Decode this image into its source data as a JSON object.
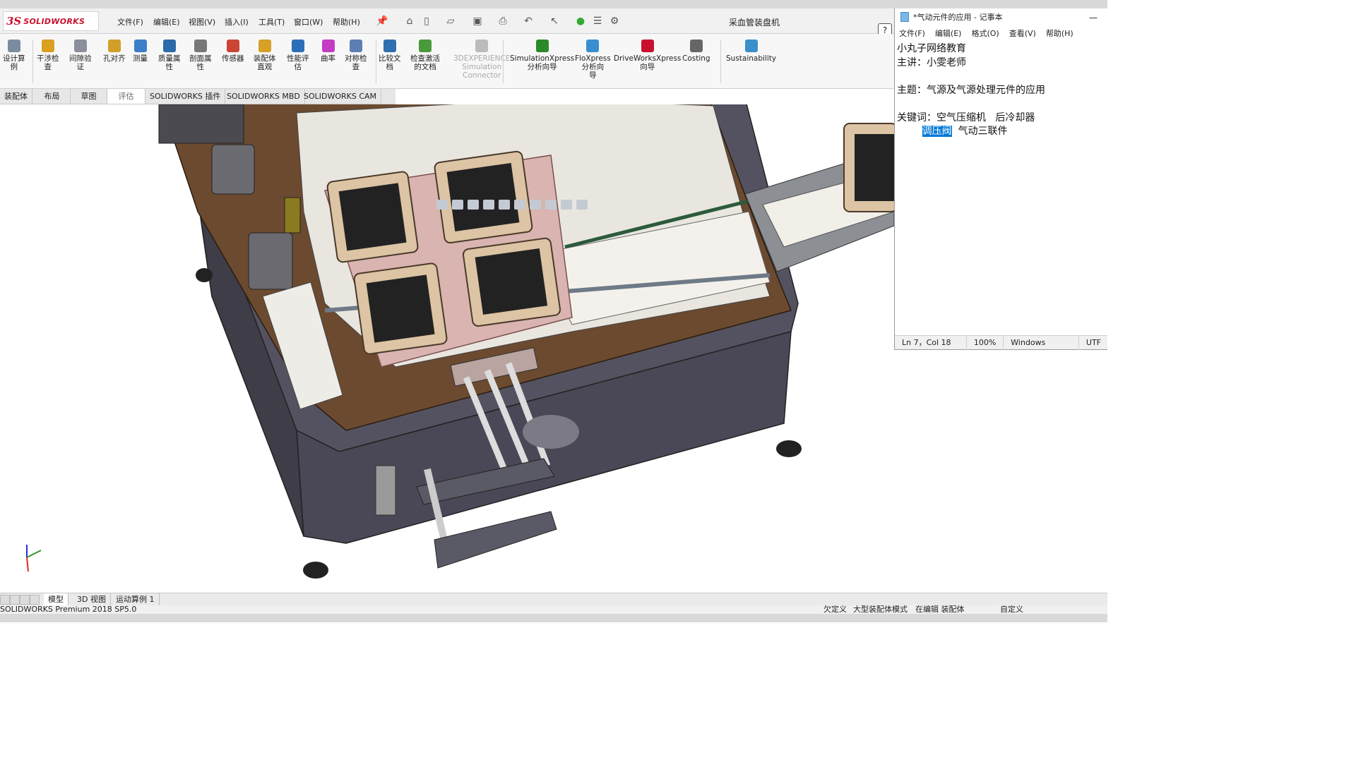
{
  "app": {
    "logo_text": "SOLIDWORKS",
    "logo_mark": "3S",
    "doc_title": "采血管装盘机",
    "help": "?"
  },
  "menu": [
    "文件(F)",
    "编辑(E)",
    "视图(V)",
    "插入(I)",
    "工具(T)",
    "窗口(W)",
    "帮助(H)"
  ],
  "ribbon": [
    {
      "label": "设计算\n例"
    },
    {
      "label": "干涉检\n查"
    },
    {
      "label": "间隙验\n证"
    },
    {
      "label": "孔对齐"
    },
    {
      "label": "测量"
    },
    {
      "label": "质量属\n性"
    },
    {
      "label": "剖面属\n性"
    },
    {
      "label": "传感器"
    },
    {
      "label": "装配体\n直观"
    },
    {
      "label": "性能评\n估"
    },
    {
      "label": "曲率"
    },
    {
      "label": "对称检\n查"
    },
    {
      "label": "比较文\n档"
    },
    {
      "label": "检查激活\n的文档"
    },
    {
      "label": "3DEXPERIENCE\nSimulation\nConnector"
    },
    {
      "label": "SimulationXpress\n分析向导"
    },
    {
      "label": "FloXpress\n分析向\n导"
    },
    {
      "label": "DriveWorksXpress\n向导"
    },
    {
      "label": "Costing"
    },
    {
      "label": "Sustainability"
    }
  ],
  "tabs": [
    "装配体",
    "布局",
    "草图",
    "评估",
    "SOLIDWORKS 插件",
    "SOLIDWORKS MBD",
    "SOLIDWORKS CAM"
  ],
  "notepad": {
    "title": "*气动元件的应用 - 记事本",
    "menu": [
      "文件(F)",
      "编辑(E)",
      "格式(O)",
      "查看(V)",
      "帮助(H)"
    ],
    "lines": [
      "小丸子网络教育",
      "主讲：小雯老师",
      "",
      "主题：气源及气源处理元件的应用",
      "",
      "关键词：空气压缩机   后冷却器"
    ],
    "line7_pre": "        ",
    "line7_sel": "调压阀",
    "line7_post": "  气动三联件",
    "status": [
      "Ln 7，Col 18",
      "100%",
      "Windows (CRLF)",
      "UTF"
    ]
  },
  "bottom_tabs": [
    "模型",
    "3D 视图",
    "运动算例 1"
  ],
  "status": {
    "left": "SOLIDWORKS Premium 2018 SP5.0",
    "r1": "欠定义",
    "r2": "大型装配体模式",
    "r3": "在编辑 装配体",
    "r4": "自定义"
  }
}
